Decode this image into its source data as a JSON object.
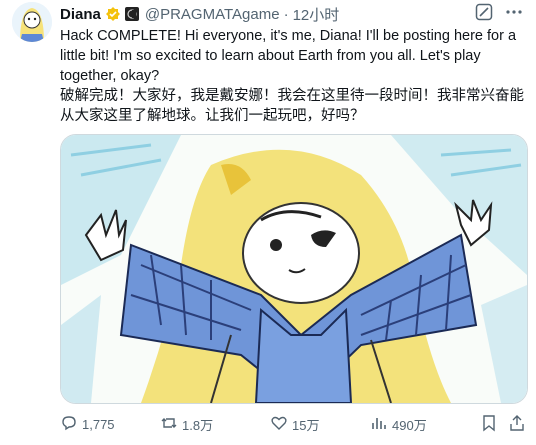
{
  "tweet": {
    "author_name": "Diana",
    "handle": "@PRAGMATAgame",
    "separator": "·",
    "time": "12小时",
    "text_en": "Hack COMPLETE! Hi everyone, it's me, Diana! I'll be posting here for a little bit! I'm so excited to learn about Earth from you all. Let's play together, okay?",
    "text_zh": "破解完成！大家好，我是戴安娜！我会在这里待一段时间！我非常兴奋能从大家这里了解地球。让我们一起玩吧，好吗？",
    "media": {
      "type": "crayon-drawing"
    }
  },
  "actions": {
    "reply_count": "1,775",
    "retweet_count": "1.8万",
    "like_count": "15万",
    "view_count": "490万"
  },
  "icons": {
    "verified": "gold-badge-icon",
    "affiliate": "org-badge-icon",
    "grok": "grok-icon",
    "more": "more-icon",
    "reply": "reply-icon",
    "retweet": "retweet-icon",
    "like": "heart-icon",
    "views": "views-icon",
    "bookmark": "bookmark-icon",
    "share": "share-icon"
  },
  "colors": {
    "text": "#0f1419",
    "muted": "#536471",
    "verified_gold": "#f4c20d"
  }
}
